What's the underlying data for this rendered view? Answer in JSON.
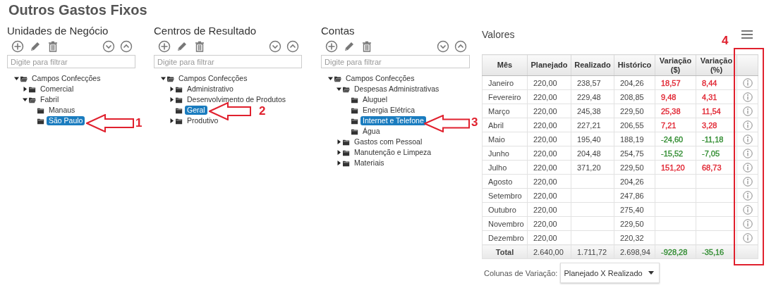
{
  "title": "Outros Gastos Fixos",
  "panels": [
    {
      "heading": "Unidades de Negócio",
      "filter": {
        "placeholder": "Digite para filtrar"
      },
      "tree": [
        {
          "label": "Campos Confecções",
          "expanded": true,
          "selected": false,
          "children": [
            {
              "label": "Comercial",
              "expanded": false,
              "selected": false
            },
            {
              "label": "Fabril",
              "expanded": true,
              "selected": false,
              "children": [
                {
                  "label": "Manaus",
                  "selected": false
                },
                {
                  "label": "São Paulo",
                  "selected": true
                }
              ]
            }
          ]
        }
      ]
    },
    {
      "heading": "Centros de Resultado",
      "filter": {
        "placeholder": "Digite para filtrar"
      },
      "tree": [
        {
          "label": "Campos Confecções",
          "expanded": true,
          "selected": false,
          "children": [
            {
              "label": "Administrativo",
              "expanded": false,
              "selected": false
            },
            {
              "label": "Desenvolvimento de Produtos",
              "expanded": false,
              "selected": false
            },
            {
              "label": "Geral",
              "selected": true
            },
            {
              "label": "Produtivo",
              "expanded": false,
              "selected": false
            }
          ]
        }
      ]
    },
    {
      "heading": "Contas",
      "filter": {
        "placeholder": "Digite para filtrar"
      },
      "tree": [
        {
          "label": "Campos Confecções",
          "expanded": true,
          "selected": false,
          "children": [
            {
              "label": "Despesas Administrativas",
              "expanded": true,
              "selected": false,
              "children": [
                {
                  "label": "Aluguel",
                  "selected": false
                },
                {
                  "label": "Energia Elétrica",
                  "selected": false
                },
                {
                  "label": "Internet e Telefone",
                  "selected": true
                },
                {
                  "label": "Água",
                  "selected": false
                }
              ]
            },
            {
              "label": "Gastos com Pessoal",
              "expanded": false,
              "selected": false
            },
            {
              "label": "Manutenção e Limpeza",
              "expanded": false,
              "selected": false
            },
            {
              "label": "Materiais",
              "expanded": false,
              "selected": false
            }
          ]
        }
      ]
    }
  ],
  "values": {
    "heading": "Valores",
    "columns": [
      "Mês",
      "Planejado",
      "Realizado",
      "Histórico",
      "Variação ($)",
      "Variação (%)"
    ],
    "rows": [
      {
        "month": "Janeiro",
        "planned": "220,00",
        "realized": "238,57",
        "historical": "204,26",
        "var_abs": "18,57",
        "var_pct": "8,44",
        "color": "#e0212e"
      },
      {
        "month": "Fevereiro",
        "planned": "220,00",
        "realized": "229,48",
        "historical": "208,85",
        "var_abs": "9,48",
        "var_pct": "4,31",
        "color": "#e0212e"
      },
      {
        "month": "Março",
        "planned": "220,00",
        "realized": "245,38",
        "historical": "229,50",
        "var_abs": "25,38",
        "var_pct": "11,54",
        "color": "#e0212e"
      },
      {
        "month": "Abril",
        "planned": "220,00",
        "realized": "227,21",
        "historical": "206,55",
        "var_abs": "7,21",
        "var_pct": "3,28",
        "color": "#e0212e"
      },
      {
        "month": "Maio",
        "planned": "220,00",
        "realized": "195,40",
        "historical": "188,19",
        "var_abs": "-24,60",
        "var_pct": "-11,18",
        "color": "#2e8b2e"
      },
      {
        "month": "Junho",
        "planned": "220,00",
        "realized": "204,48",
        "historical": "254,75",
        "var_abs": "-15,52",
        "var_pct": "-7,05",
        "color": "#2e8b2e"
      },
      {
        "month": "Julho",
        "planned": "220,00",
        "realized": "371,20",
        "historical": "229,50",
        "var_abs": "151,20",
        "var_pct": "68,73",
        "color": "#e0212e"
      },
      {
        "month": "Agosto",
        "planned": "220,00",
        "historical": "204,26"
      },
      {
        "month": "Setembro",
        "planned": "220,00",
        "historical": "247,86"
      },
      {
        "month": "Outubro",
        "planned": "220,00",
        "historical": "275,40"
      },
      {
        "month": "Novembro",
        "planned": "220,00",
        "historical": "229,50"
      },
      {
        "month": "Dezembro",
        "planned": "220,00",
        "historical": "220,32"
      }
    ],
    "total": {
      "month": "Total",
      "planned": "2.640,00",
      "realized": "1.711,72",
      "historical": "2.698,94",
      "var_abs": "-928,28",
      "var_pct": "-35,16",
      "color": "#2e8b2e"
    },
    "variation_select": {
      "label": "Colunas de Variação:",
      "value": "Planejado X Realizado"
    }
  },
  "annotations": [
    {
      "kind": "arrow",
      "label": "1"
    },
    {
      "kind": "arrow",
      "label": "2"
    },
    {
      "kind": "arrow",
      "label": "3"
    },
    {
      "kind": "box",
      "label": "4"
    }
  ]
}
